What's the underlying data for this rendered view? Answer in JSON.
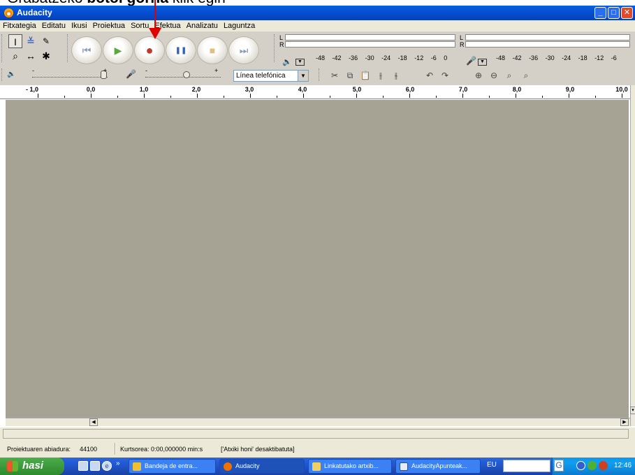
{
  "annotation": {
    "prefix": "Grabatzeko ",
    "bold": "botoi gorria",
    "suffix": " klik egin"
  },
  "window": {
    "title": "Audacity",
    "minimize": "_",
    "maximize": "□",
    "close": "✕"
  },
  "menu": [
    "Fitxategia",
    "Editatu",
    "Ikusi",
    "Proiektua",
    "Sortu",
    "Efektua",
    "Analizatu",
    "Laguntza"
  ],
  "tools": {
    "select": "I",
    "envelope": "≚",
    "draw": "✎",
    "zoom": "⌕",
    "timeshift": "↔",
    "multi": "✱"
  },
  "transport": {
    "skip_start": "⏮",
    "play": "▶",
    "record": "●",
    "pause": "❚❚",
    "stop": "■",
    "skip_end": "⏭"
  },
  "meters": {
    "left": "L",
    "right": "R",
    "play_scale": [
      "-48",
      "-42",
      "-36",
      "-30",
      "-24",
      "-18",
      "-12",
      "-6",
      "0"
    ],
    "rec_scale": [
      "-48",
      "-42",
      "-36",
      "-30",
      "-24",
      "-18",
      "-12",
      "-6"
    ]
  },
  "mixer": {
    "input_source": "Línea telefónica",
    "output_min": "-",
    "output_max": "+"
  },
  "ruler": [
    "- 1,0",
    "0,0",
    "1,0",
    "2,0",
    "3,0",
    "4,0",
    "5,0",
    "6,0",
    "7,0",
    "8,0",
    "9,0",
    "10,0"
  ],
  "status": {
    "rate_label": "Proiektuaren abiadura:",
    "rate_value": "44100",
    "cursor": "Kurtsorea: 0:00,000000 min:s",
    "snap": "['Atxiki honi' desaktibatuta]"
  },
  "taskbar": {
    "start": "hasi",
    "more": "»",
    "tasks": [
      "Bandeja de entra...",
      "Audacity",
      "Linkatutako artxib...",
      "AudacityApunteak..."
    ],
    "lang": "EU",
    "clock": "12:46"
  },
  "colors": {
    "record": "#c0372c",
    "play": "#5aa83e",
    "pause": "#2f5fbf",
    "accent": "#e00000",
    "workarea": "#a6a394"
  }
}
